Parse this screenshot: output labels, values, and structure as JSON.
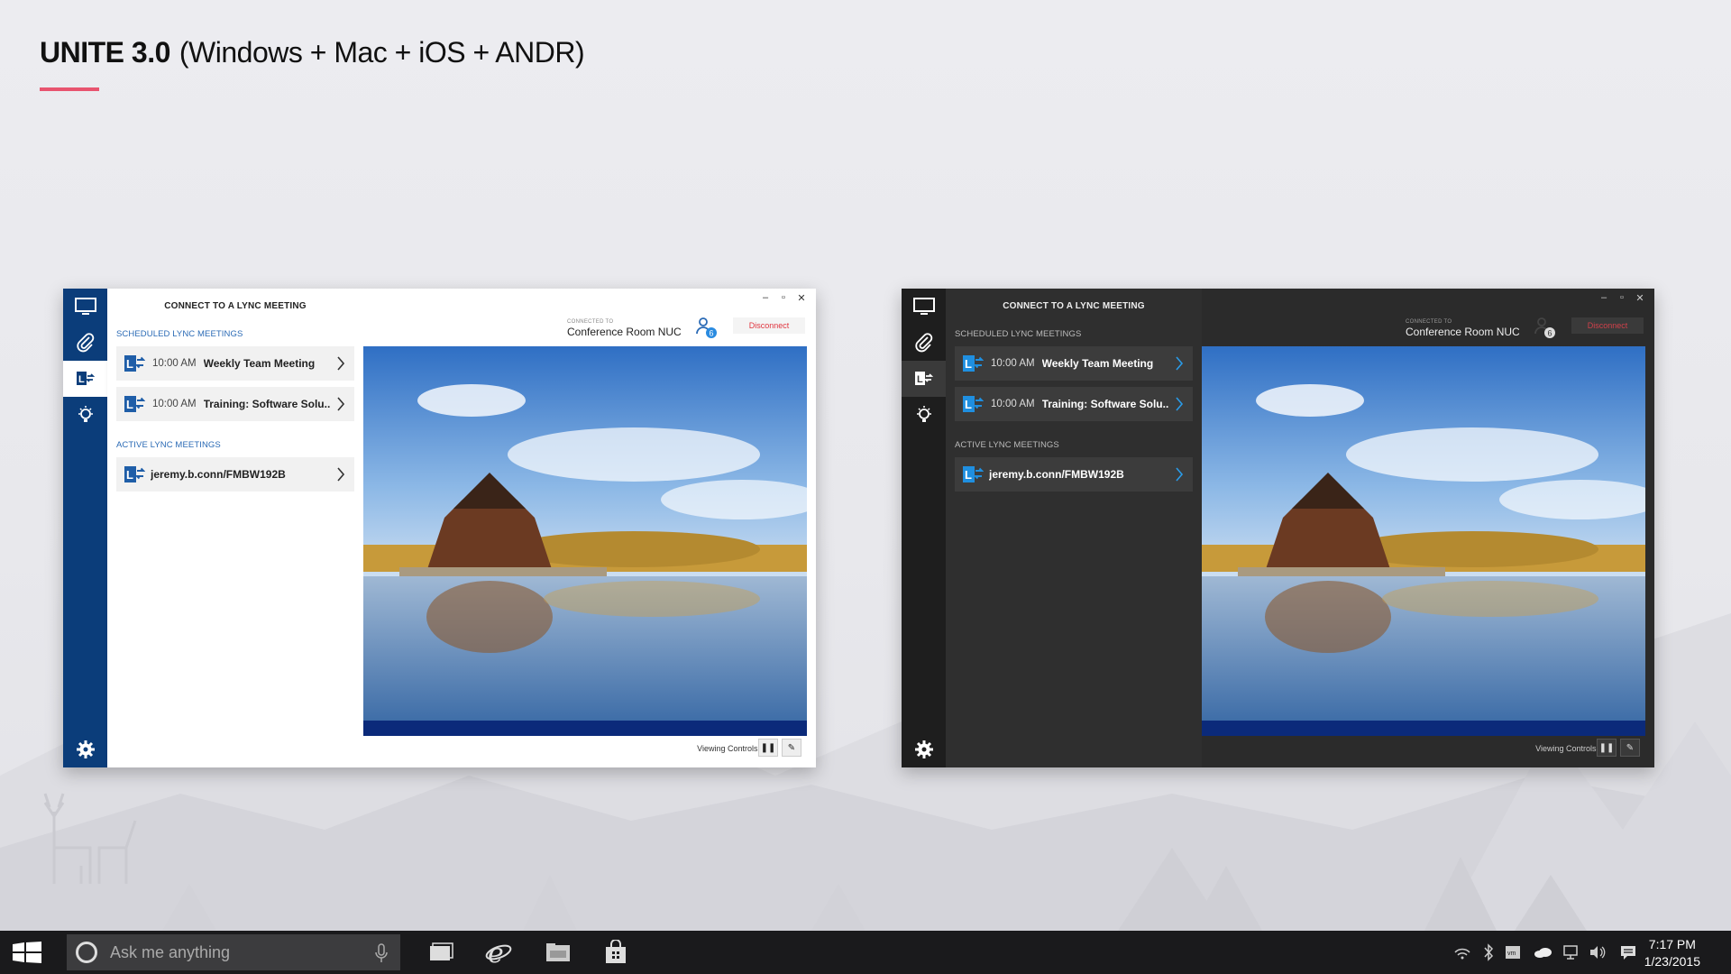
{
  "header": {
    "brand": "UNITE 3.0",
    "subtitle": "(Windows + Mac + iOS + ANDR)"
  },
  "colors": {
    "accent": "#e8546f",
    "light_rail": "#0b3d7a",
    "lync_blue": "#1f8fe0",
    "disconnect": "#e0353f"
  },
  "app": {
    "panel_title": "CONNECT TO A LYNC MEETING",
    "scheduled_label": "SCHEDULED LYNC MEETINGS",
    "active_label": "ACTIVE LYNC MEETINGS",
    "scheduled": [
      {
        "time": "10:00 AM",
        "title": "Weekly Team Meeting"
      },
      {
        "time": "10:00 AM",
        "title": "Training: Software Solu..."
      }
    ],
    "active": [
      {
        "title": "jeremy.b.conn/FMBW192B"
      }
    ],
    "connected_to_label": "CONNECTED TO",
    "room": "Conference Room NUC",
    "user_count": "6",
    "disconnect": "Disconnect",
    "viewing_controls": "Viewing Controls:",
    "nav_icons": [
      "monitor-icon",
      "paperclip-icon",
      "lync-icon",
      "lightbulb-icon",
      "gear-icon"
    ]
  },
  "taskbar": {
    "search_placeholder": "Ask me anything",
    "time": "7:17 PM",
    "date": "1/23/2015"
  }
}
